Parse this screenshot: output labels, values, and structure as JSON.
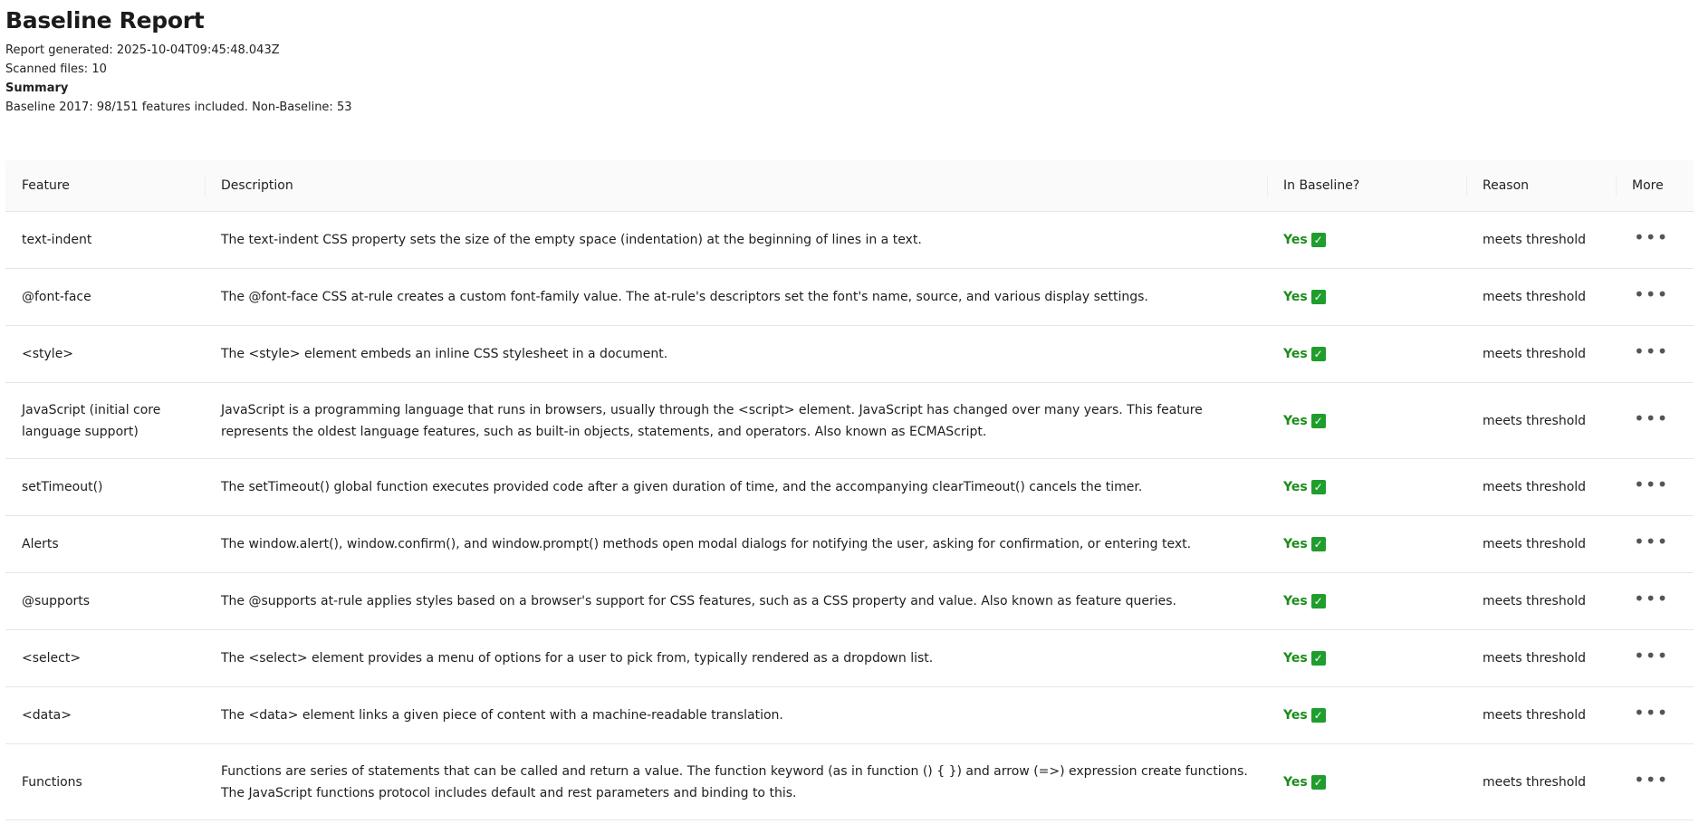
{
  "report": {
    "title": "Baseline Report",
    "generated_label": "Report generated:",
    "generated_value": "2025-10-04T09:45:48.043Z",
    "scanned_label": "Scanned files:",
    "scanned_value": "10",
    "summary_title": "Summary",
    "summary_text": "Baseline 2017: 98/151 features included. Non-Baseline: 53"
  },
  "table": {
    "headers": {
      "feature": "Feature",
      "description": "Description",
      "in_baseline": "In Baseline?",
      "reason": "Reason",
      "more": "More"
    },
    "rows": [
      {
        "feature": "text-indent",
        "description": "The text-indent CSS property sets the size of the empty space (indentation) at the beginning of lines in a text.",
        "status": "Yes",
        "reason": "meets threshold",
        "more": "•••"
      },
      {
        "feature": "@font-face",
        "description": "The @font-face CSS at-rule creates a custom font-family value. The at-rule's descriptors set the font's name, source, and various display settings.",
        "status": "Yes",
        "reason": "meets threshold",
        "more": "•••"
      },
      {
        "feature": "<style>",
        "description": "The <style> element embeds an inline CSS stylesheet in a document.",
        "status": "Yes",
        "reason": "meets threshold",
        "more": "•••"
      },
      {
        "feature": "JavaScript (initial core language support)",
        "description": "JavaScript is a programming language that runs in browsers, usually through the <script> element. JavaScript has changed over many years. This feature represents the oldest language features, such as built-in objects, statements, and operators. Also known as ECMAScript.",
        "status": "Yes",
        "reason": "meets threshold",
        "more": "•••"
      },
      {
        "feature": "setTimeout()",
        "description": "The setTimeout() global function executes provided code after a given duration of time, and the accompanying clearTimeout() cancels the timer.",
        "status": "Yes",
        "reason": "meets threshold",
        "more": "•••"
      },
      {
        "feature": "Alerts",
        "description": "The window.alert(), window.confirm(), and window.prompt() methods open modal dialogs for notifying the user, asking for confirmation, or entering text.",
        "status": "Yes",
        "reason": "meets threshold",
        "more": "•••"
      },
      {
        "feature": "@supports",
        "description": "The @supports at-rule applies styles based on a browser's support for CSS features, such as a CSS property and value. Also known as feature queries.",
        "status": "Yes",
        "reason": "meets threshold",
        "more": "•••"
      },
      {
        "feature": "<select>",
        "description": "The <select> element provides a menu of options for a user to pick from, typically rendered as a dropdown list.",
        "status": "Yes",
        "reason": "meets threshold",
        "more": "•••"
      },
      {
        "feature": "<data>",
        "description": "The <data> element links a given piece of content with a machine-readable translation.",
        "status": "Yes",
        "reason": "meets threshold",
        "more": "•••"
      },
      {
        "feature": "Functions",
        "description": "Functions are series of statements that can be called and return a value. The function keyword (as in function () { }) and arrow (=>) expression create functions. The JavaScript functions protocol includes default and rest parameters and binding to this.",
        "status": "Yes",
        "reason": "meets threshold",
        "more": "•••"
      }
    ]
  },
  "icons": {
    "check": "check-box-icon",
    "more": "more-horizontal-icon"
  },
  "colors": {
    "yes_text": "#1a8d1a",
    "check_bg": "#1f9d2d"
  }
}
